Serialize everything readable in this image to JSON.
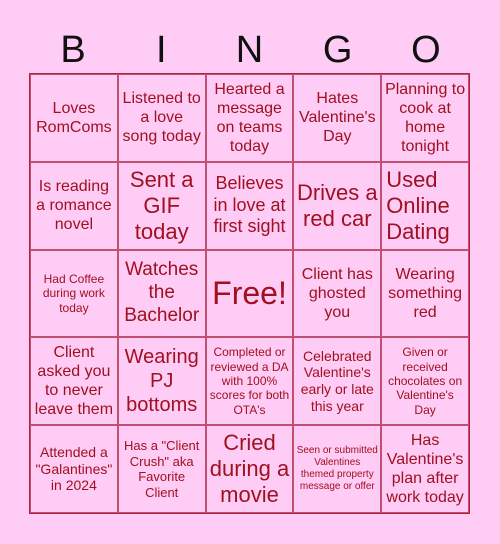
{
  "header": {
    "letters": [
      "B",
      "I",
      "N",
      "G",
      "O"
    ]
  },
  "colors": {
    "background": "#ffccf5",
    "text": "#a01020",
    "grid_line": "#b02040"
  },
  "cells": [
    "Loves RomComs",
    "Listened to a love song today",
    "Hearted a message on teams today",
    "Hates Valentine's Day",
    "Planning to cook at home tonight",
    "Is reading a romance novel",
    "Sent a GIF today",
    "Believes in love at first sight",
    "Drives a red car",
    "Used Online Dating",
    "Had Coffee during work today",
    "Watches the Bachelor",
    "Free!",
    "Client has ghosted you",
    "Wearing something red",
    "Client asked you to never leave them",
    "Wearing PJ bottoms",
    "Completed or reviewed a DA with 100% scores for both OTA's",
    "Celebrated Valentine's early or late this year",
    "Given or received chocolates on Valentine's Day",
    "Attended a \"Galantines\" in 2024",
    "Has a \"Client Crush\" aka Favorite Client",
    "Cried during a movie",
    "Seen or submitted Valentines themed property message or offer",
    "Has Valentine's plan after work today"
  ]
}
